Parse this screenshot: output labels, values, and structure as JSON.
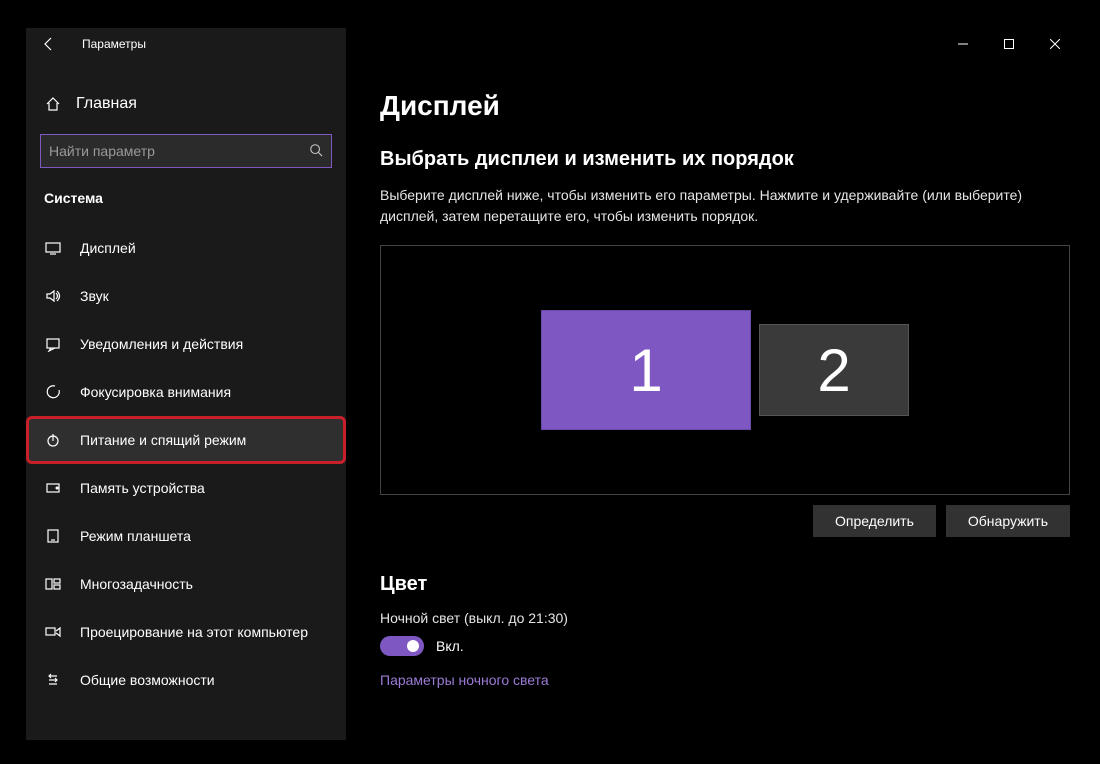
{
  "window": {
    "title": "Параметры"
  },
  "sidebar": {
    "home": "Главная",
    "search_placeholder": "Найти параметр",
    "category": "Система",
    "items": [
      {
        "label": "Дисплей",
        "icon": "display"
      },
      {
        "label": "Звук",
        "icon": "sound"
      },
      {
        "label": "Уведомления и действия",
        "icon": "notifications"
      },
      {
        "label": "Фокусировка внимания",
        "icon": "focus"
      },
      {
        "label": "Питание и спящий режим",
        "icon": "power",
        "highlighted": true
      },
      {
        "label": "Память устройства",
        "icon": "storage"
      },
      {
        "label": "Режим планшета",
        "icon": "tablet"
      },
      {
        "label": "Многозадачность",
        "icon": "multitask"
      },
      {
        "label": "Проецирование на этот компьютер",
        "icon": "project"
      },
      {
        "label": "Общие возможности",
        "icon": "shared"
      }
    ]
  },
  "content": {
    "page_title": "Дисплей",
    "section_arrange_title": "Выбрать дисплеи и изменить их порядок",
    "section_arrange_desc": "Выберите дисплей ниже, чтобы изменить его параметры. Нажмите и удерживайте (или выберите) дисплей, затем перетащите его, чтобы изменить порядок.",
    "monitors": [
      {
        "id": "1",
        "primary": true
      },
      {
        "id": "2",
        "primary": false
      }
    ],
    "btn_identify": "Определить",
    "btn_detect": "Обнаружить",
    "section_color_title": "Цвет",
    "night_light_label": "Ночной свет (выкл. до 21:30)",
    "toggle_on_label": "Вкл.",
    "night_light_settings_link": "Параметры ночного света"
  }
}
